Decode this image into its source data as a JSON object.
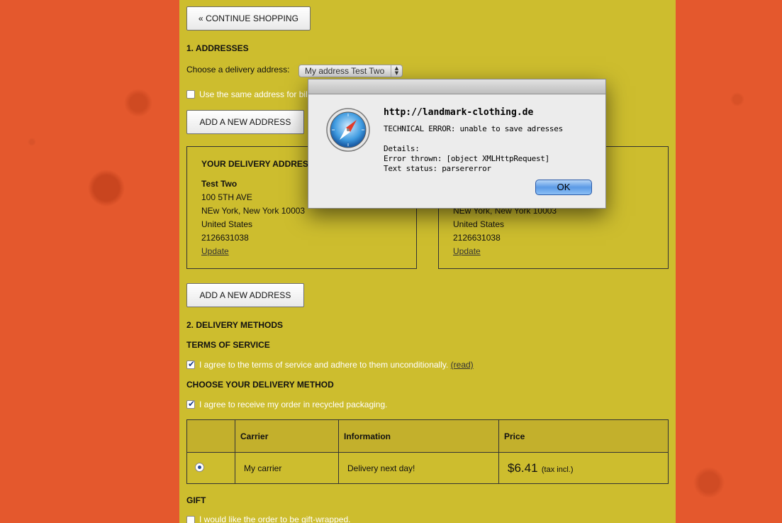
{
  "colors": {
    "background": "#e4582d",
    "panel": "#cdbd2e",
    "dialog_button": "#5b9ae6"
  },
  "continue_label": "« CONTINUE SHOPPING",
  "addresses": {
    "heading": "1. ADDRESSES",
    "choose_label": "Choose a delivery address:",
    "selected_address": "My address Test Two",
    "same_address_label": "Use the same address for billing.",
    "add_label": "ADD A NEW ADDRESS",
    "delivery_box": {
      "title": "YOUR DELIVERY ADDRESS",
      "name": "Test Two",
      "street": "100 5TH AVE",
      "city": "NEw York, New York 10003",
      "country": "United States",
      "phone": "2126631038",
      "update": "Update"
    },
    "billing_box": {
      "city": "NEw York, New York 10003",
      "country": "United States",
      "phone": "2126631038",
      "update": "Update"
    },
    "add_label_2": "ADD A NEW ADDRESS"
  },
  "delivery": {
    "heading": "2. DELIVERY METHODS",
    "tos_heading": "TERMS OF SERVICE",
    "tos_text": "I agree to the terms of service and adhere to them unconditionally.",
    "tos_link": "(read)",
    "method_heading": "CHOOSE YOUR DELIVERY METHOD",
    "recycled_text": "I agree to receive my order in recycled packaging.",
    "table": {
      "headers": [
        "",
        "Carrier",
        "Information",
        "Price"
      ],
      "row": {
        "carrier": "My carrier",
        "information": "Delivery next day!",
        "price": "$6.41",
        "tax": "(tax incl.)"
      }
    }
  },
  "gift": {
    "heading": "GIFT",
    "text": "I would like the order to be gift-wrapped."
  },
  "dialog": {
    "icon": "safari-compass-icon",
    "host": "http://landmark-clothing.de",
    "error": "TECHNICAL ERROR: unable to save adresses",
    "details_label": "Details:",
    "error_thrown": "Error thrown: [object XMLHttpRequest]",
    "text_status": "Text status: parsererror",
    "ok_label": "OK"
  }
}
